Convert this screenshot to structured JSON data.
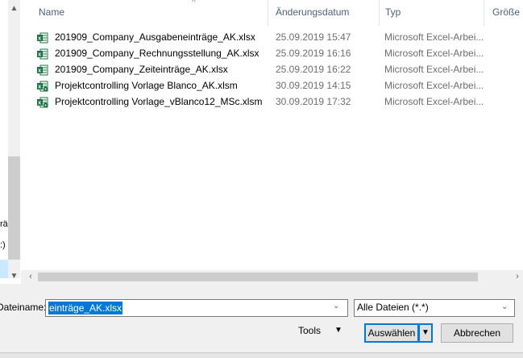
{
  "header": {
    "col_name": "Name",
    "col_date": "Änderungsdatum",
    "col_type": "Typ",
    "col_size": "Größe"
  },
  "nav": {
    "fragment_1": "rä",
    "fragment_2": ":)"
  },
  "files": [
    {
      "name": "201909_Company_Ausgabeneinträge_AK.xlsx",
      "date": "25.09.2019 15:47",
      "type": "Microsoft Excel-Arbei..."
    },
    {
      "name": "201909_Company_Rechnungsstellung_AK.xlsx",
      "date": "25.09.2019 16:16",
      "type": "Microsoft Excel-Arbei..."
    },
    {
      "name": "201909_Company_Zeiteinträge_AK.xlsx",
      "date": "25.09.2019 16:22",
      "type": "Microsoft Excel-Arbei..."
    },
    {
      "name": "Projektcontrolling Vorlage Blanco_AK.xlsm",
      "date": "30.09.2019 14:15",
      "type": "Microsoft Excel-Arbei..."
    },
    {
      "name": "Projektcontrolling Vorlage_vBlanco12_MSc.xlsm",
      "date": "30.09.2019 17:32",
      "type": "Microsoft Excel-Arbei..."
    }
  ],
  "footer": {
    "filename_label": "Dateiname:",
    "filename_value": "einträge_AK.xlsx",
    "filter_value": "Alle Dateien (*.*)",
    "tools_label": "Tools",
    "select_label": "Auswählen",
    "cancel_label": "Abbrechen"
  },
  "colors": {
    "accent": "#0078d7",
    "excel_green": "#1e7145"
  }
}
